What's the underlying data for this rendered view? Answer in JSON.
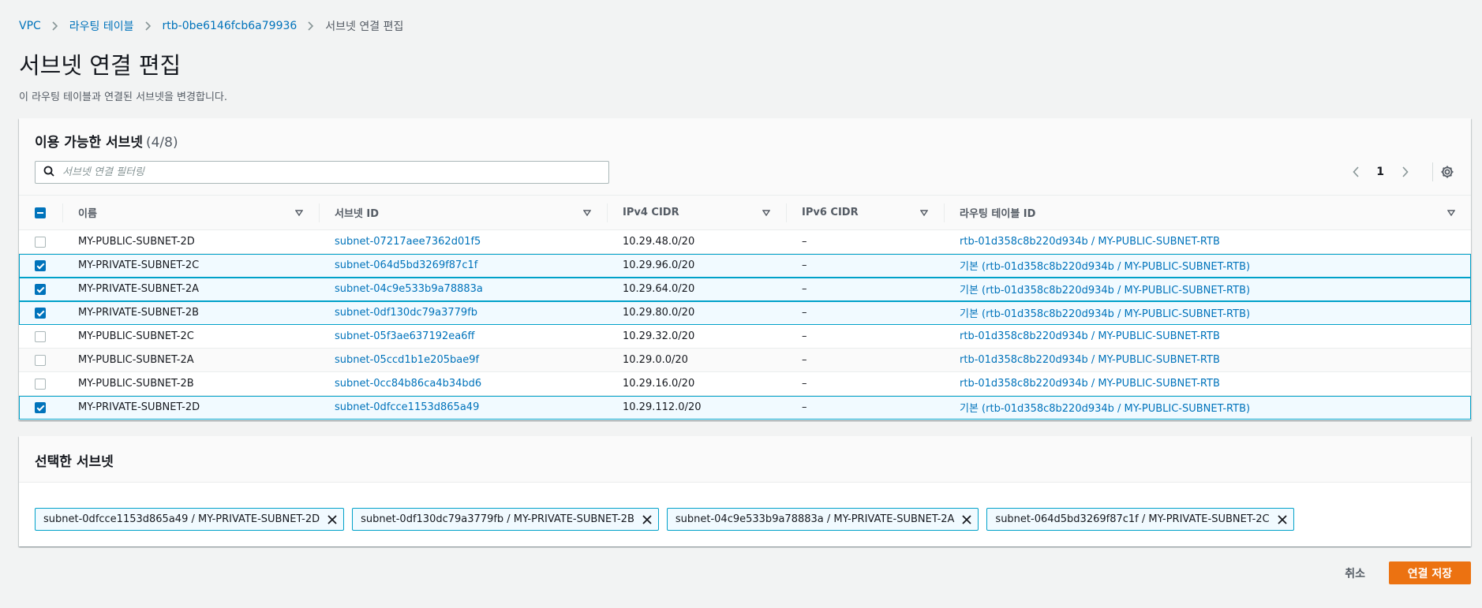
{
  "breadcrumb": [
    {
      "label": "VPC",
      "link": true
    },
    {
      "label": "라우팅 테이블",
      "link": true
    },
    {
      "label": "rtb-0be6146fcb6a79936",
      "link": true
    },
    {
      "label": "서브넷 연결 편집",
      "link": false
    }
  ],
  "page": {
    "title": "서브넷 연결 편집",
    "description": "이 라우팅 테이블과 연결된 서브넷을 변경합니다."
  },
  "available": {
    "title": "이용 가능한 서브넷",
    "count": "(4/8)",
    "filter_placeholder": "서브넷 연결 필터링",
    "page_number": "1",
    "columns": [
      "이름",
      "서브넷 ID",
      "IPv4 CIDR",
      "IPv6 CIDR",
      "라우팅 테이블 ID"
    ],
    "rows": [
      {
        "checked": false,
        "name": "MY-PUBLIC-SUBNET-2D",
        "subnet_id": "subnet-07217aee7362d01f5",
        "ipv4": "10.29.48.0/20",
        "ipv6": "–",
        "rtb": "rtb-01d358c8b220d934b / MY-PUBLIC-SUBNET-RTB"
      },
      {
        "checked": true,
        "name": "MY-PRIVATE-SUBNET-2C",
        "subnet_id": "subnet-064d5bd3269f87c1f",
        "ipv4": "10.29.96.0/20",
        "ipv6": "–",
        "rtb": "기본 (rtb-01d358c8b220d934b / MY-PUBLIC-SUBNET-RTB)"
      },
      {
        "checked": true,
        "name": "MY-PRIVATE-SUBNET-2A",
        "subnet_id": "subnet-04c9e533b9a78883a",
        "ipv4": "10.29.64.0/20",
        "ipv6": "–",
        "rtb": "기본 (rtb-01d358c8b220d934b / MY-PUBLIC-SUBNET-RTB)"
      },
      {
        "checked": true,
        "name": "MY-PRIVATE-SUBNET-2B",
        "subnet_id": "subnet-0df130dc79a3779fb",
        "ipv4": "10.29.80.0/20",
        "ipv6": "–",
        "rtb": "기본 (rtb-01d358c8b220d934b / MY-PUBLIC-SUBNET-RTB)"
      },
      {
        "checked": false,
        "name": "MY-PUBLIC-SUBNET-2C",
        "subnet_id": "subnet-05f3ae637192ea6ff",
        "ipv4": "10.29.32.0/20",
        "ipv6": "–",
        "rtb": "rtb-01d358c8b220d934b / MY-PUBLIC-SUBNET-RTB"
      },
      {
        "checked": false,
        "name": "MY-PUBLIC-SUBNET-2A",
        "subnet_id": "subnet-05ccd1b1e205bae9f",
        "ipv4": "10.29.0.0/20",
        "ipv6": "–",
        "rtb": "rtb-01d358c8b220d934b / MY-PUBLIC-SUBNET-RTB"
      },
      {
        "checked": false,
        "name": "MY-PUBLIC-SUBNET-2B",
        "subnet_id": "subnet-0cc84b86ca4b34bd6",
        "ipv4": "10.29.16.0/20",
        "ipv6": "–",
        "rtb": "rtb-01d358c8b220d934b / MY-PUBLIC-SUBNET-RTB"
      },
      {
        "checked": true,
        "name": "MY-PRIVATE-SUBNET-2D",
        "subnet_id": "subnet-0dfcce1153d865a49",
        "ipv4": "10.29.112.0/20",
        "ipv6": "–",
        "rtb": "기본 (rtb-01d358c8b220d934b / MY-PUBLIC-SUBNET-RTB)"
      }
    ]
  },
  "selected": {
    "title": "선택한 서브넷",
    "tokens": [
      "subnet-0dfcce1153d865a49 / MY-PRIVATE-SUBNET-2D",
      "subnet-0df130dc79a3779fb / MY-PRIVATE-SUBNET-2B",
      "subnet-04c9e533b9a78883a / MY-PRIVATE-SUBNET-2A",
      "subnet-064d5bd3269f87c1f / MY-PRIVATE-SUBNET-2C"
    ]
  },
  "actions": {
    "cancel_label": "취소",
    "save_label": "연결 저장"
  },
  "colors": {
    "link": "#0073bb",
    "primary": "#ec7211",
    "selected_border": "#00a1c9",
    "selected_bg": "#f1faff"
  },
  "icons": {
    "filter": "search-icon",
    "sort": "caret-down-icon",
    "settings": "gear-icon",
    "remove": "close-icon"
  }
}
